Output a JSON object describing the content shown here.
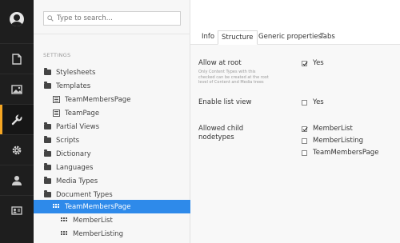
{
  "rail": {
    "items": [
      {
        "icon": "content-icon"
      },
      {
        "icon": "media-icon"
      },
      {
        "icon": "settings-wrench-icon"
      },
      {
        "icon": "developer-gear-icon"
      },
      {
        "icon": "users-icon"
      },
      {
        "icon": "members-icon"
      }
    ],
    "active_index": 2,
    "accent_color": "#f5a623"
  },
  "search": {
    "placeholder": "Type to search..."
  },
  "tree": {
    "section_header": "SETTINGS",
    "nodes": [
      {
        "label": "Stylesheets",
        "icon": "folder-icon"
      },
      {
        "label": "Templates",
        "icon": "folder-icon"
      },
      {
        "label": "TeamMembersPage",
        "icon": "template-icon"
      },
      {
        "label": "TeamPage",
        "icon": "template-icon"
      },
      {
        "label": "Partial Views",
        "icon": "folder-icon"
      },
      {
        "label": "Scripts",
        "icon": "folder-icon"
      },
      {
        "label": "Dictionary",
        "icon": "folder-icon"
      },
      {
        "label": "Languages",
        "icon": "folder-icon"
      },
      {
        "label": "Media Types",
        "icon": "folder-icon"
      },
      {
        "label": "Document Types",
        "icon": "folder-icon"
      },
      {
        "label": "TeamMembersPage",
        "icon": "doctype-icon",
        "selected": true
      },
      {
        "label": "MemberList",
        "icon": "doctype-icon"
      },
      {
        "label": "MemberListing",
        "icon": "doctype-icon"
      }
    ],
    "selected_color": "#2e8aea"
  },
  "tabs": [
    "Info",
    "Structure",
    "Generic properties",
    "Tabs"
  ],
  "active_tab": "Structure",
  "structure": {
    "allow_at_root": {
      "label": "Allow at root",
      "description": "Only Content Types with this checked can be created at the root level of Content and Media trees",
      "value": "Yes",
      "checked": true
    },
    "enable_list_view": {
      "label": "Enable list view",
      "value": "Yes",
      "checked": false
    },
    "allowed_child_nodetypes": {
      "label_line1": "Allowed child",
      "label_line2": "nodetypes",
      "options": [
        {
          "label": "MemberList",
          "checked": true
        },
        {
          "label": "MemberListing",
          "checked": false
        },
        {
          "label": "TeamMembersPage",
          "checked": false
        }
      ]
    }
  }
}
